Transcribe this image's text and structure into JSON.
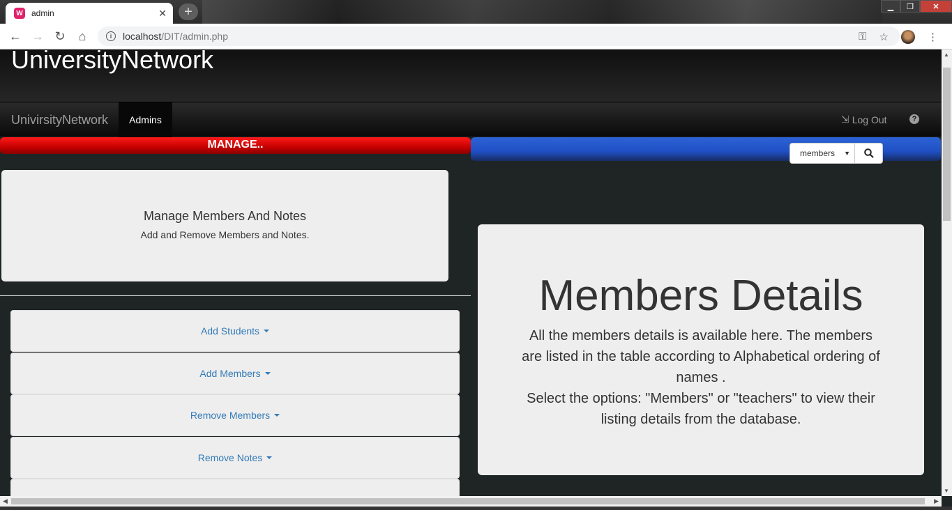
{
  "browser": {
    "tab_title": "admin",
    "favicon_text": "W",
    "new_tab_label": "+",
    "url_host": "localhost",
    "url_path": "/DIT/admin.php",
    "accent": "#e0226c"
  },
  "header": {
    "site_title": "UniversityNetwork"
  },
  "navbar": {
    "brand": "UnivirsityNetwork",
    "active_item": "Admins",
    "logout": "Log Out",
    "help": "?"
  },
  "manage": {
    "bar_label": "MANAGE..",
    "box_title": "Manage Members And Notes",
    "box_subtitle": "Add and Remove Members and Notes."
  },
  "search": {
    "selected_option": "members"
  },
  "panels": [
    {
      "label": "Add Students"
    },
    {
      "label": "Add Members"
    },
    {
      "label": "Remove Members"
    },
    {
      "label": "Remove Notes"
    }
  ],
  "details": {
    "title": "Members Details",
    "text1": "All the members details is available here. The members are listed in the table according to Alphabetical ordering of names .",
    "text2": "Select the options: \"Members\" or \"teachers\" to view their listing details from the database."
  },
  "colors": {
    "manage_bar": "#e00000",
    "search_bar": "#2458cf",
    "link": "#337ab7"
  }
}
